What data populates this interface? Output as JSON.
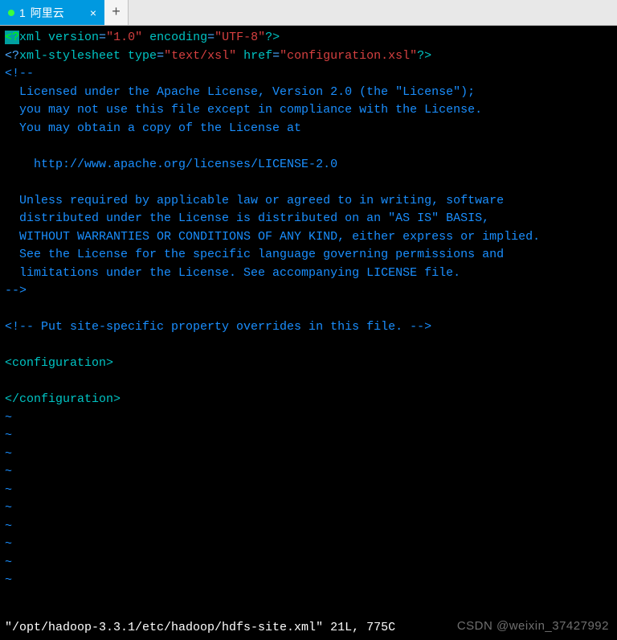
{
  "tab": {
    "index": "1",
    "title": "阿里云",
    "close_glyph": "×",
    "new_glyph": "+"
  },
  "code": {
    "l1": {
      "a": "<?",
      "b": "xml",
      "c": " version",
      "d": "=",
      "e": "\"1.0\"",
      "f": " encoding",
      "g": "=",
      "h": "\"UTF-8\"",
      "i": "?>"
    },
    "l2": {
      "a": "<?",
      "b": "xml-stylesheet",
      "c": " type",
      "d": "=",
      "e": "\"text/xsl\"",
      "f": " href",
      "g": "=",
      "h": "\"configuration.xsl\"",
      "i": "?>"
    },
    "comment_open": "<!--",
    "c1": "  Licensed under the Apache License, Version 2.0 (the \"License\");",
    "c2": "  you may not use this file except in compliance with the License.",
    "c3": "  You may obtain a copy of the License at",
    "c4": " ",
    "c5": "    http://www.apache.org/licenses/LICENSE-2.0",
    "c6": " ",
    "c7": "  Unless required by applicable law or agreed to in writing, software",
    "c8": "  distributed under the License is distributed on an \"AS IS\" BASIS,",
    "c9": "  WITHOUT WARRANTIES OR CONDITIONS OF ANY KIND, either express or implied.",
    "c10": "  See the License for the specific language governing permissions and",
    "c11": "  limitations under the License. See accompanying LICENSE file.",
    "comment_close": "-->",
    "blank": " ",
    "override_comment": "<!-- Put site-specific property overrides in this file. -->",
    "conf_open": {
      "a": "<",
      "b": "configuration",
      "c": ">"
    },
    "conf_close": {
      "a": "</",
      "b": "configuration",
      "c": ">"
    },
    "tilde": "~"
  },
  "status": "\"/opt/hadoop-3.3.1/etc/hadoop/hdfs-site.xml\" 21L, 775C",
  "watermark": "CSDN @weixin_37427992"
}
